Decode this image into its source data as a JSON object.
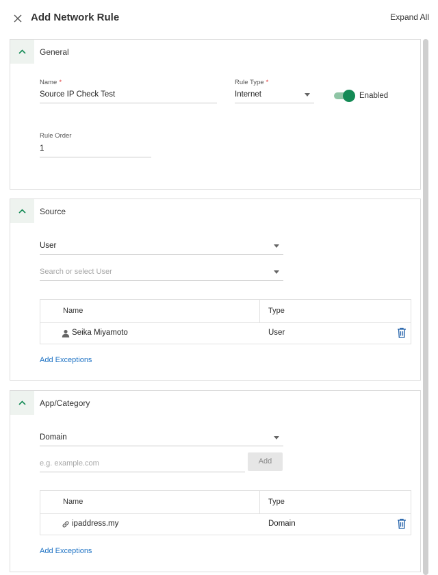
{
  "header": {
    "title": "Add Network Rule",
    "expand_all": "Expand All"
  },
  "general": {
    "title": "General",
    "name_label": "Name",
    "name_required": "*",
    "name_value": "Source IP Check Test",
    "rule_type_label": "Rule Type",
    "rule_type_required": "*",
    "rule_type_value": "Internet",
    "enabled_label": "Enabled",
    "enabled": true,
    "rule_order_label": "Rule Order",
    "rule_order_value": "1"
  },
  "source": {
    "title": "Source",
    "type_select": "User",
    "search_placeholder": "Search or select User",
    "table": {
      "col_name": "Name",
      "col_type": "Type",
      "rows": [
        {
          "name": "Seika Miyamoto",
          "type": "User",
          "icon": "user-icon"
        }
      ]
    },
    "add_exceptions": "Add Exceptions"
  },
  "app_category": {
    "title": "App/Category",
    "type_select": "Domain",
    "domain_placeholder": "e.g. example.com",
    "add_label": "Add",
    "table": {
      "col_name": "Name",
      "col_type": "Type",
      "rows": [
        {
          "name": "ipaddress.my",
          "type": "Domain",
          "icon": "link-icon"
        }
      ]
    },
    "add_exceptions": "Add Exceptions"
  },
  "colors": {
    "accent_green": "#138a55",
    "link_blue": "#1f73c4",
    "required_red": "#e03c3c",
    "trash_blue": "#1f5fa8"
  }
}
